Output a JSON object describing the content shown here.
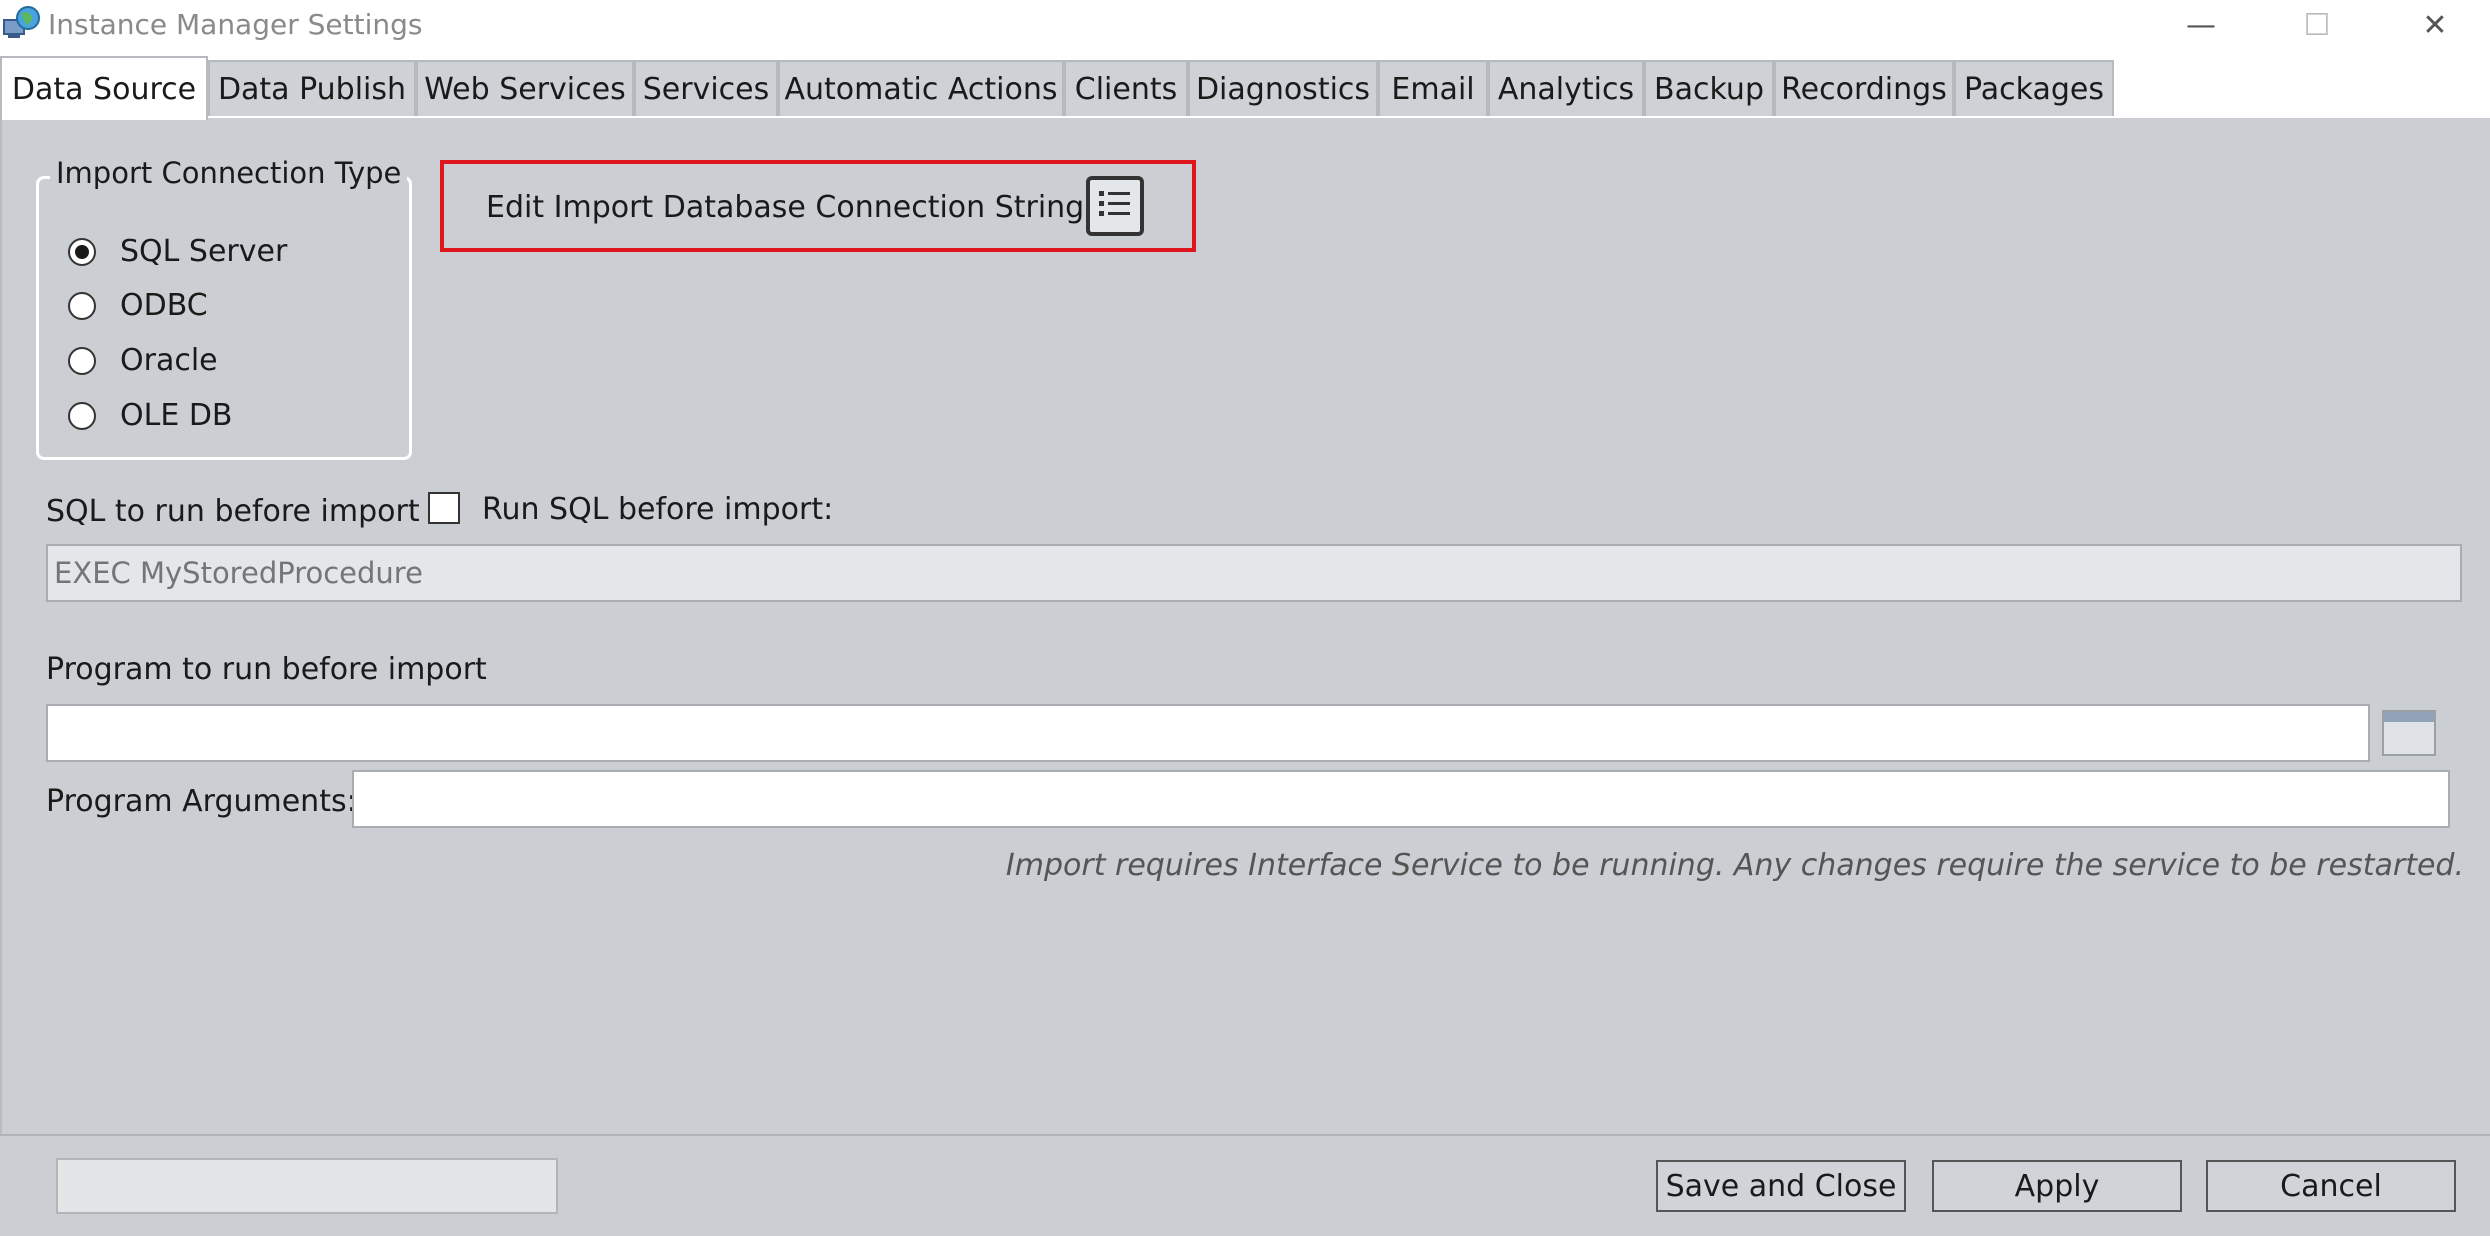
{
  "window": {
    "title": "Instance Manager Settings",
    "minimize": "—",
    "maximize": "☐",
    "close": "✕"
  },
  "tabs": [
    {
      "label": "Data Source",
      "active": true
    },
    {
      "label": "Data Publish"
    },
    {
      "label": "Web Services"
    },
    {
      "label": "Services"
    },
    {
      "label": "Automatic Actions"
    },
    {
      "label": "Clients"
    },
    {
      "label": "Diagnostics"
    },
    {
      "label": "Email"
    },
    {
      "label": "Analytics"
    },
    {
      "label": "Backup"
    },
    {
      "label": "Recordings"
    },
    {
      "label": "Packages"
    }
  ],
  "import_connection": {
    "title": "Import Connection Type",
    "options": [
      {
        "label": "SQL Server",
        "selected": true
      },
      {
        "label": "ODBC",
        "selected": false
      },
      {
        "label": "Oracle",
        "selected": false
      },
      {
        "label": "OLE DB",
        "selected": false
      }
    ]
  },
  "edit_connection": {
    "label": "Edit Import Database Connection String",
    "icon": "list-icon"
  },
  "sql_before": {
    "label": "SQL to run before import",
    "checkbox_label": "Run SQL before import:",
    "checked": false,
    "placeholder": "EXEC MyStoredProcedure"
  },
  "program": {
    "label": "Program to run before import",
    "value": "",
    "args_label": "Program Arguments:",
    "args_value": ""
  },
  "note": "Import requires Interface Service to be running. Any changes require the service to be restarted.",
  "footer": {
    "save_close": "Save and Close",
    "apply": "Apply",
    "cancel": "Cancel"
  },
  "colors": {
    "highlight": "#e0161f",
    "panel": "#cbcfd3"
  }
}
